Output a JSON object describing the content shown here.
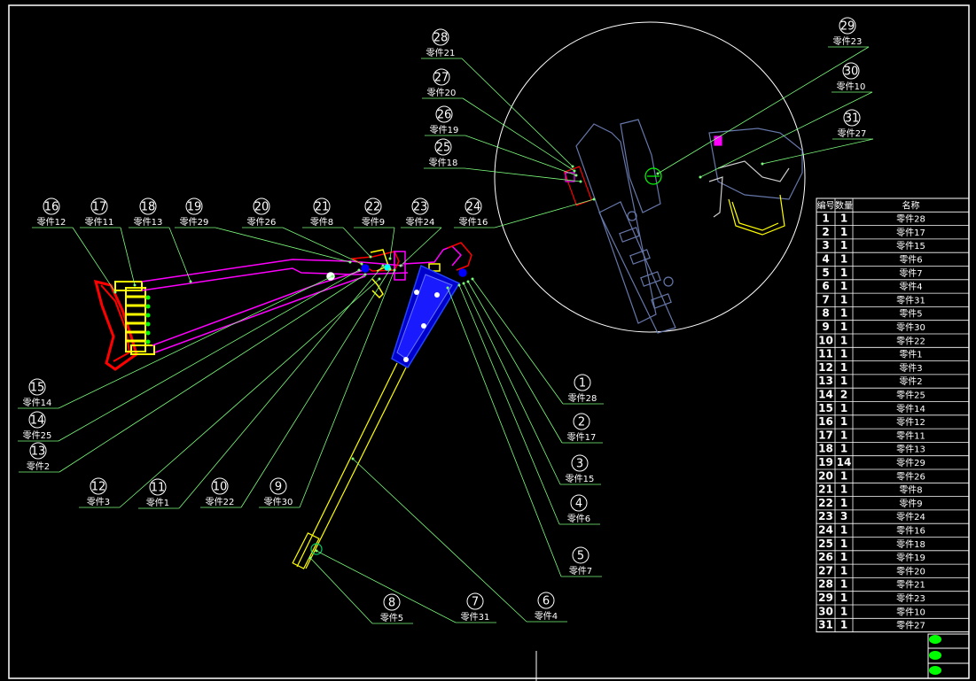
{
  "balloons": [
    {
      "num": "1",
      "label": "零件28"
    },
    {
      "num": "2",
      "label": "零件17"
    },
    {
      "num": "3",
      "label": "零件15"
    },
    {
      "num": "4",
      "label": "零件6"
    },
    {
      "num": "5",
      "label": "零件7"
    },
    {
      "num": "6",
      "label": "零件4"
    },
    {
      "num": "7",
      "label": "零件31"
    },
    {
      "num": "8",
      "label": "零件5"
    },
    {
      "num": "9",
      "label": "零件30"
    },
    {
      "num": "10",
      "label": "零件22"
    },
    {
      "num": "11",
      "label": "零件1"
    },
    {
      "num": "12",
      "label": "零件3"
    },
    {
      "num": "13",
      "label": "零件2"
    },
    {
      "num": "14",
      "label": "零件25"
    },
    {
      "num": "15",
      "label": "零件14"
    },
    {
      "num": "16",
      "label": "零件12"
    },
    {
      "num": "17",
      "label": "零件11"
    },
    {
      "num": "18",
      "label": "零件13"
    },
    {
      "num": "19",
      "label": "零件29"
    },
    {
      "num": "20",
      "label": "零件26"
    },
    {
      "num": "21",
      "label": "零件8"
    },
    {
      "num": "22",
      "label": "零件9"
    },
    {
      "num": "23",
      "label": "零件24"
    },
    {
      "num": "24",
      "label": "零件16"
    },
    {
      "num": "25",
      "label": "零件18"
    },
    {
      "num": "26",
      "label": "零件19"
    },
    {
      "num": "27",
      "label": "零件20"
    },
    {
      "num": "28",
      "label": "零件21"
    },
    {
      "num": "29",
      "label": "零件23"
    },
    {
      "num": "30",
      "label": "零件10"
    },
    {
      "num": "31",
      "label": "零件27"
    }
  ],
  "bom": {
    "headers": [
      "编号",
      "数量",
      "名称"
    ],
    "rows": [
      [
        "1",
        "1",
        "零件28"
      ],
      [
        "2",
        "1",
        "零件17"
      ],
      [
        "3",
        "1",
        "零件15"
      ],
      [
        "4",
        "1",
        "零件6"
      ],
      [
        "5",
        "1",
        "零件7"
      ],
      [
        "6",
        "1",
        "零件4"
      ],
      [
        "7",
        "1",
        "零件31"
      ],
      [
        "8",
        "1",
        "零件5"
      ],
      [
        "9",
        "1",
        "零件30"
      ],
      [
        "10",
        "1",
        "零件22"
      ],
      [
        "11",
        "1",
        "零件1"
      ],
      [
        "12",
        "1",
        "零件3"
      ],
      [
        "13",
        "1",
        "零件2"
      ],
      [
        "14",
        "2",
        "零件25"
      ],
      [
        "15",
        "1",
        "零件14"
      ],
      [
        "16",
        "1",
        "零件12"
      ],
      [
        "17",
        "1",
        "零件11"
      ],
      [
        "18",
        "1",
        "零件13"
      ],
      [
        "19",
        "14",
        "零件29"
      ],
      [
        "20",
        "1",
        "零件26"
      ],
      [
        "21",
        "1",
        "零件8"
      ],
      [
        "22",
        "1",
        "零件9"
      ],
      [
        "23",
        "3",
        "零件24"
      ],
      [
        "24",
        "1",
        "零件16"
      ],
      [
        "25",
        "1",
        "零件18"
      ],
      [
        "26",
        "1",
        "零件19"
      ],
      [
        "27",
        "1",
        "零件20"
      ],
      [
        "28",
        "1",
        "零件21"
      ],
      [
        "29",
        "1",
        "零件23"
      ],
      [
        "30",
        "1",
        "零件10"
      ],
      [
        "31",
        "1",
        "零件27"
      ]
    ]
  },
  "colors": {
    "background": "#000000",
    "leader": "#7CFC7C",
    "frame": "#ffffff",
    "stock": "#ff00ff",
    "butt": "#ff0000",
    "spring": "#ffff00",
    "handguard": "#0000ff",
    "barrel": "#ffff00",
    "rail": "#6677aa"
  }
}
